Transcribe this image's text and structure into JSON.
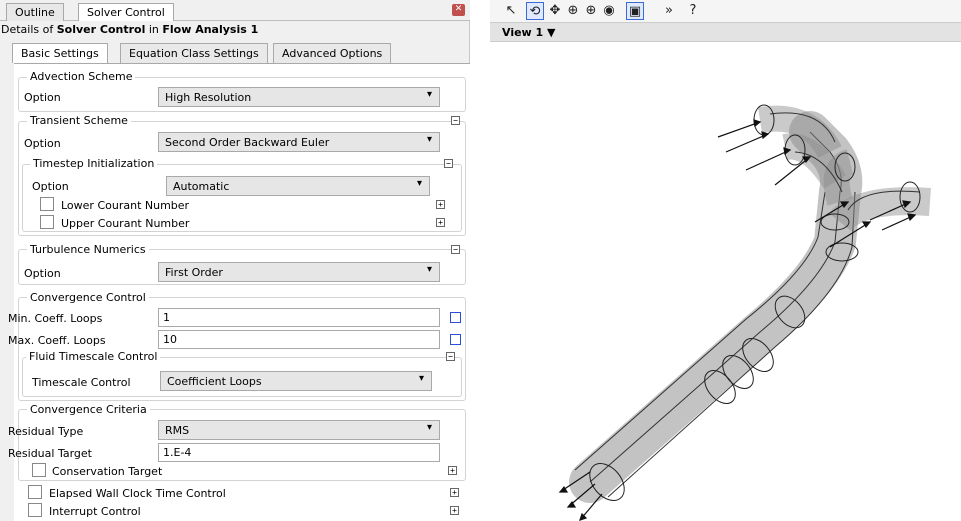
{
  "top_tabs": [
    "Outline",
    "Solver Control"
  ],
  "details": {
    "prefix": "Details of ",
    "object": "Solver Control",
    "in": " in ",
    "analysis": "Flow Analysis 1"
  },
  "sub_tabs": [
    "Basic Settings",
    "Equation Class Settings",
    "Advanced Options"
  ],
  "advection": {
    "title": "Advection Scheme",
    "label": "Option",
    "value": "High Resolution"
  },
  "transient": {
    "title": "Transient Scheme",
    "label": "Option",
    "value": "Second Order Backward Euler"
  },
  "timestep": {
    "title": "Timestep Initialization",
    "label": "Option",
    "value": "Automatic",
    "lower": "Lower Courant Number",
    "upper": "Upper Courant Number"
  },
  "turbulence": {
    "title": "Turbulence Numerics",
    "label": "Option",
    "value": "First Order"
  },
  "convergence_control": {
    "title": "Convergence Control",
    "min_label": "Min. Coeff. Loops",
    "min_value": "1",
    "max_label": "Max. Coeff. Loops",
    "max_value": "10"
  },
  "fluid_timescale": {
    "title": "Fluid Timescale Control",
    "label": "Timescale Control",
    "value": "Coefficient Loops"
  },
  "convergence_criteria": {
    "title": "Convergence Criteria",
    "type_label": "Residual Type",
    "type_value": "RMS",
    "target_label": "Residual Target",
    "target_value": "1.E-4",
    "conservation": "Conservation Target"
  },
  "elapsed": "Elapsed Wall Clock Time Control",
  "interrupt": "Interrupt Control",
  "viewport": {
    "label": "View 1"
  },
  "toolbar_icons": [
    "select-icon",
    "rotate-icon",
    "pan-icon",
    "zoom-icon",
    "zoom-box-icon",
    "zoom-fit-icon",
    "highlight-icon",
    "more-icon",
    "help-icon"
  ]
}
